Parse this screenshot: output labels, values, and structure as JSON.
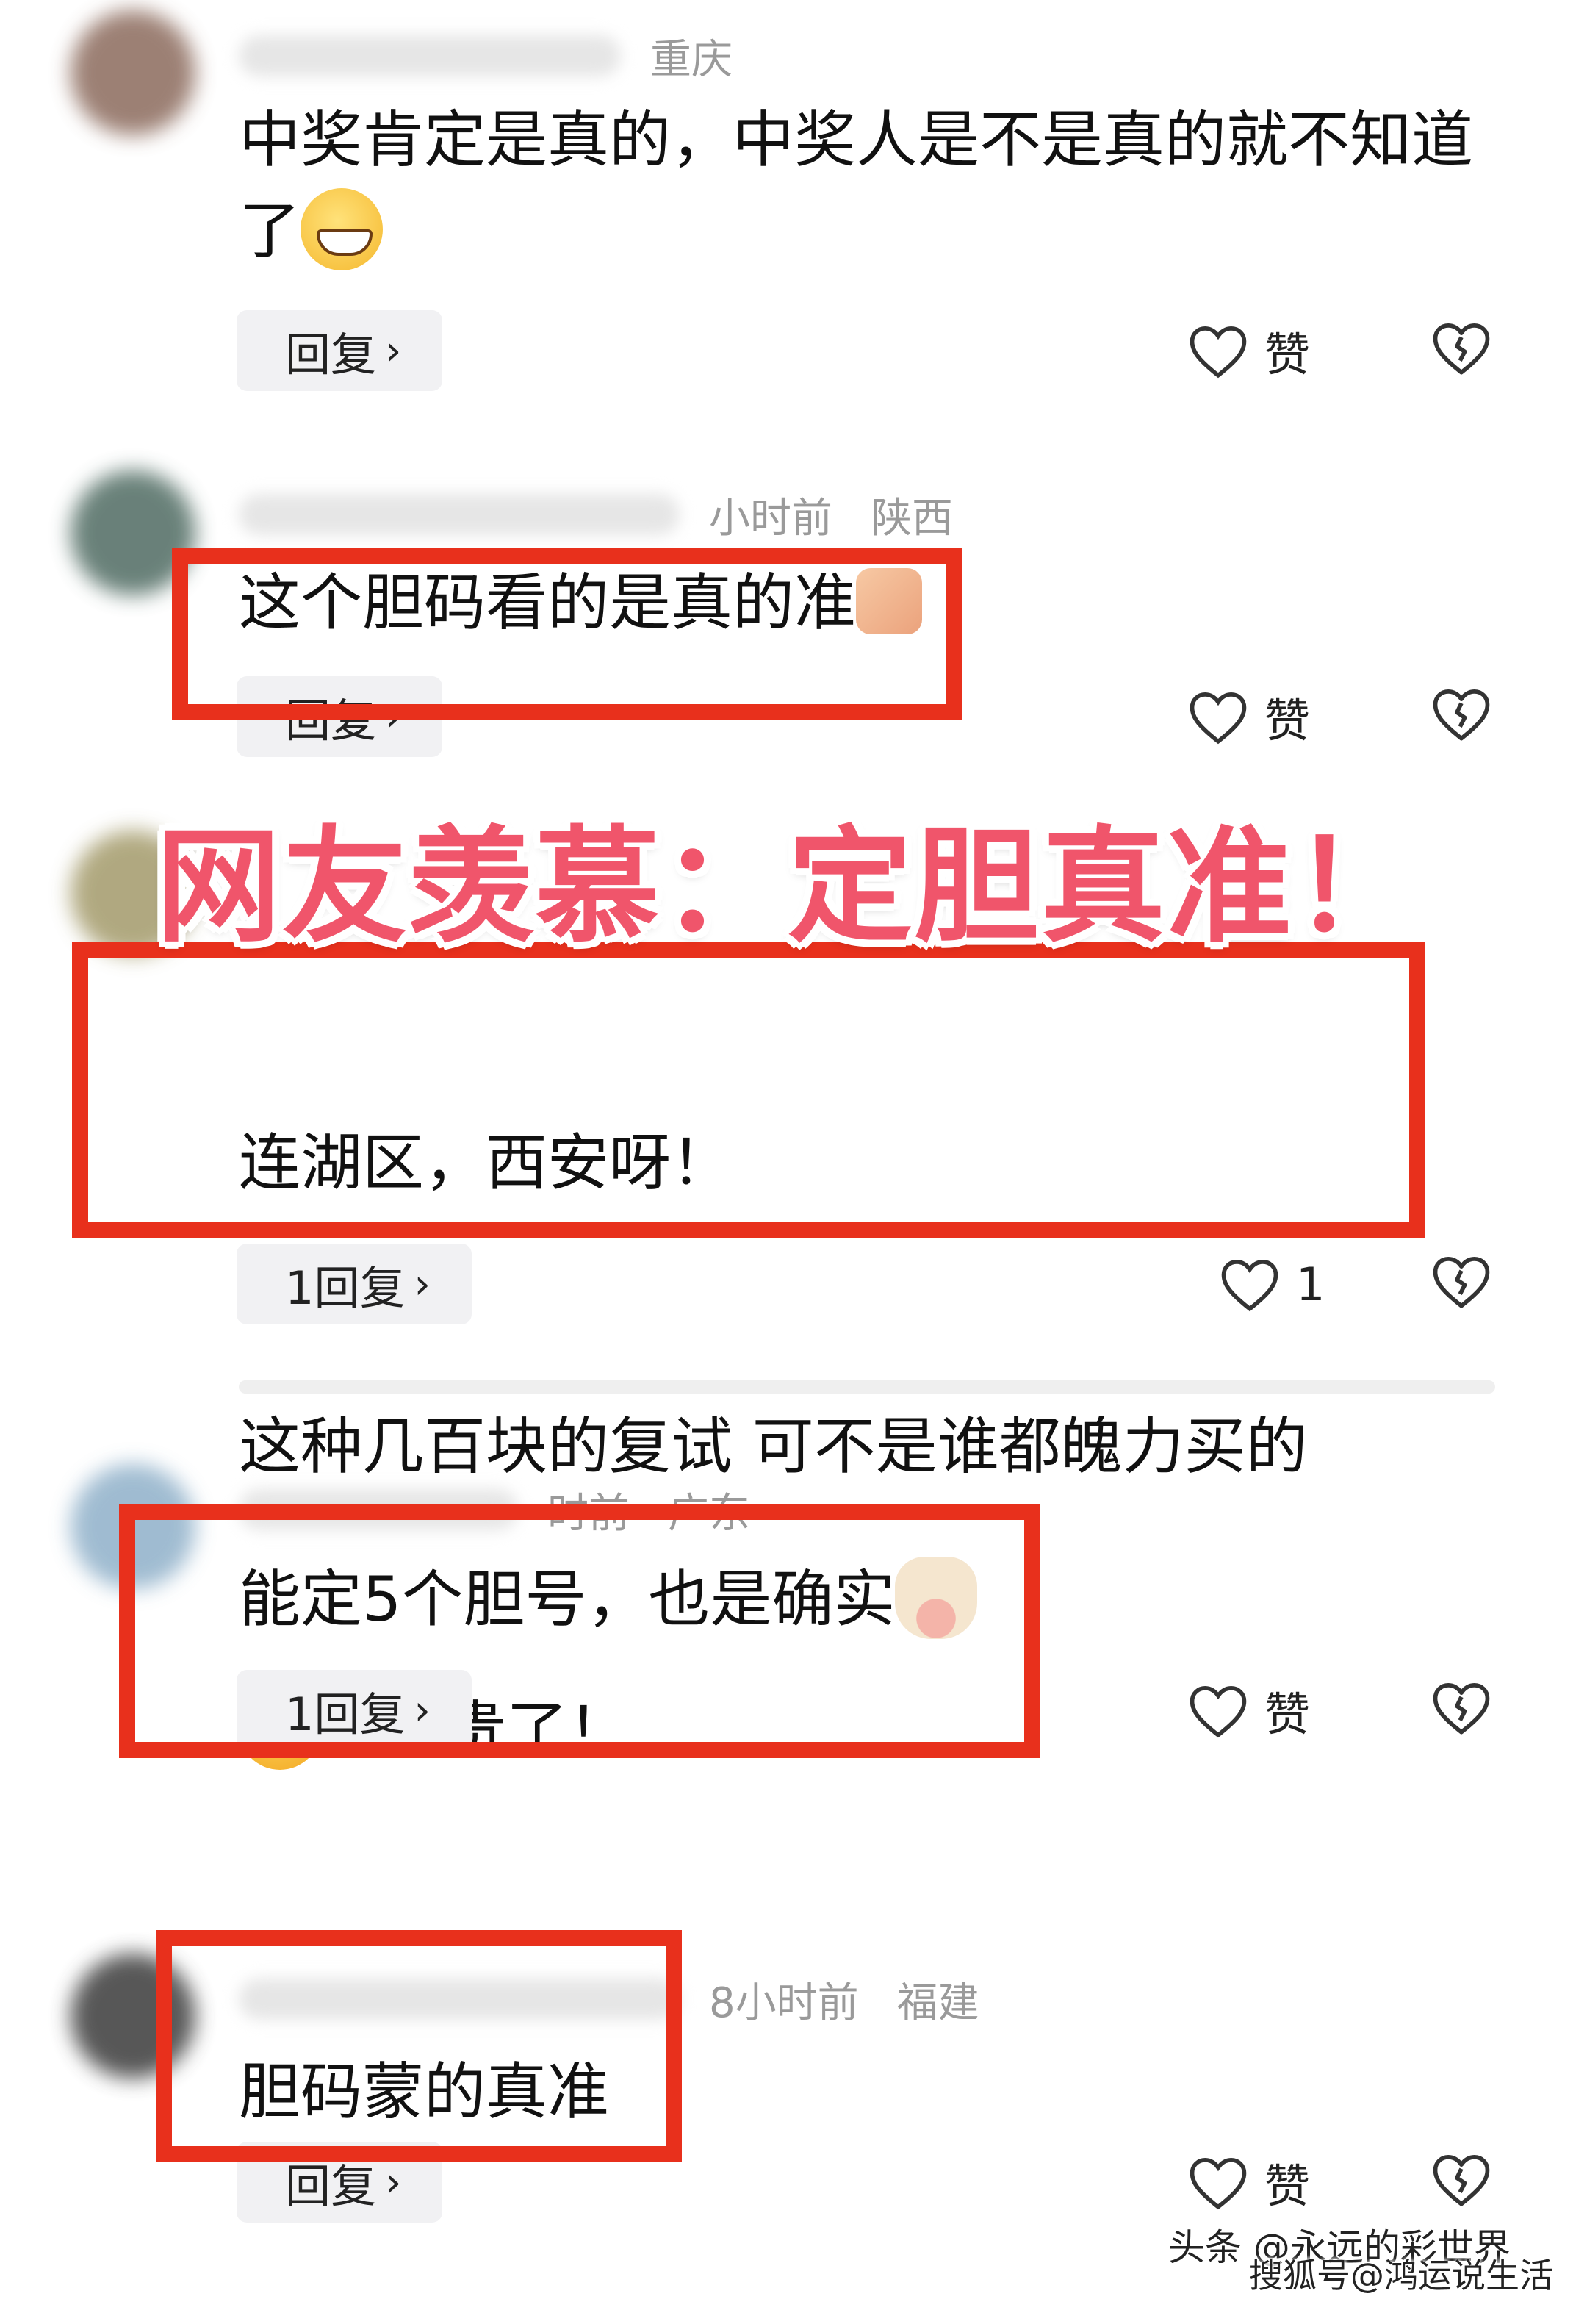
{
  "comments": [
    {
      "location": "重庆",
      "time": "",
      "text": "中奖肯定是真的，中奖人是不是真的就不知道了",
      "emoji": "grinning-face",
      "reply_label": "回复",
      "like_label": "赞"
    },
    {
      "location": "陕西",
      "time": "小时前",
      "text": "这个胆码看的是真的准",
      "emoji": "thumbs-up",
      "reply_label": "回复",
      "like_label": "赞"
    },
    {
      "location": "",
      "time": "",
      "text_line1": "连湖区，西安呀！",
      "text_line2": "这种几百块的复试 可不是谁都魄力买的",
      "text_line3": "，太贵了！",
      "emoji": "laughing-crying-face",
      "reply_label": "1回复",
      "like_label": "1"
    },
    {
      "location": "广东",
      "time": "时前",
      "text": "能定5个胆号，也是确实",
      "emoji": "cow-face",
      "reply_label": "1回复",
      "like_label": "赞"
    },
    {
      "location": "福建",
      "time": "8小时前",
      "text": "胆码蒙的真准",
      "emoji": "",
      "reply_label": "回复",
      "like_label": "赞"
    }
  ],
  "overlay": {
    "title": "网友羡慕：定胆真准！",
    "color": "#f0556b"
  },
  "highlight_color": "#e8301c",
  "watermark": {
    "line1": "头条 @永远的彩世界",
    "line2": "搜狐号@鸿运说生活"
  }
}
